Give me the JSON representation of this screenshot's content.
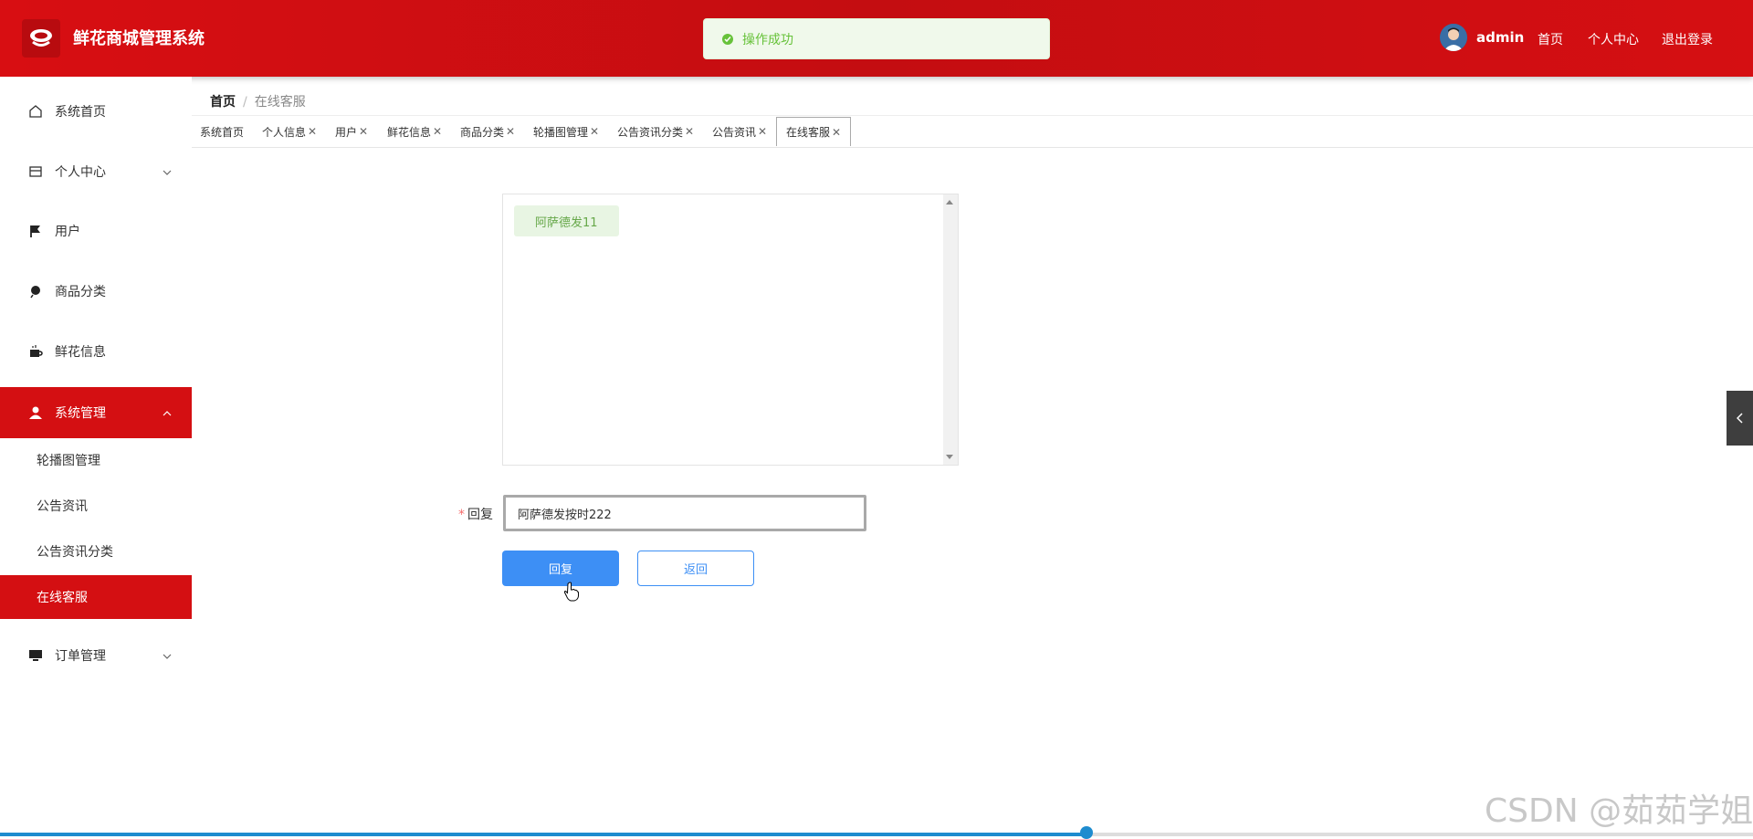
{
  "header": {
    "app_title": "鲜花商城管理系统",
    "toast": "操作成功",
    "user": "admin",
    "links": [
      "首页",
      "个人中心",
      "退出登录"
    ]
  },
  "sidebar": {
    "items": [
      {
        "label": "系统首页",
        "icon": "home-icon"
      },
      {
        "label": "个人中心",
        "icon": "wallet-icon"
      },
      {
        "label": "用户",
        "icon": "flag-icon"
      },
      {
        "label": "商品分类",
        "icon": "pin-icon"
      },
      {
        "label": "鲜花信息",
        "icon": "coffee-icon"
      },
      {
        "label": "系统管理",
        "icon": "user-icon"
      },
      {
        "label": "订单管理",
        "icon": "monitor-icon"
      }
    ],
    "sub_items": [
      "轮播图管理",
      "公告资讯",
      "公告资讯分类",
      "在线客服"
    ]
  },
  "breadcrumb": {
    "home": "首页",
    "separator": "/",
    "current": "在线客服"
  },
  "tabs": [
    "系统首页",
    "个人信息",
    "用户",
    "鲜花信息",
    "商品分类",
    "轮播图管理",
    "公告资讯分类",
    "公告资讯",
    "在线客服"
  ],
  "chat": {
    "messages": [
      "阿萨德发11"
    ]
  },
  "form": {
    "required_mark": "*",
    "reply_label": "回复",
    "reply_value": "阿萨德发按时222",
    "reply_button": "回复",
    "back_button": "返回"
  },
  "watermark": "CSDN @茹茹学姐",
  "video_progress": 0.62,
  "colors": {
    "brand_red": "#d40f12",
    "primary_blue": "#3d8ff5",
    "success_green": "#67c23a"
  }
}
